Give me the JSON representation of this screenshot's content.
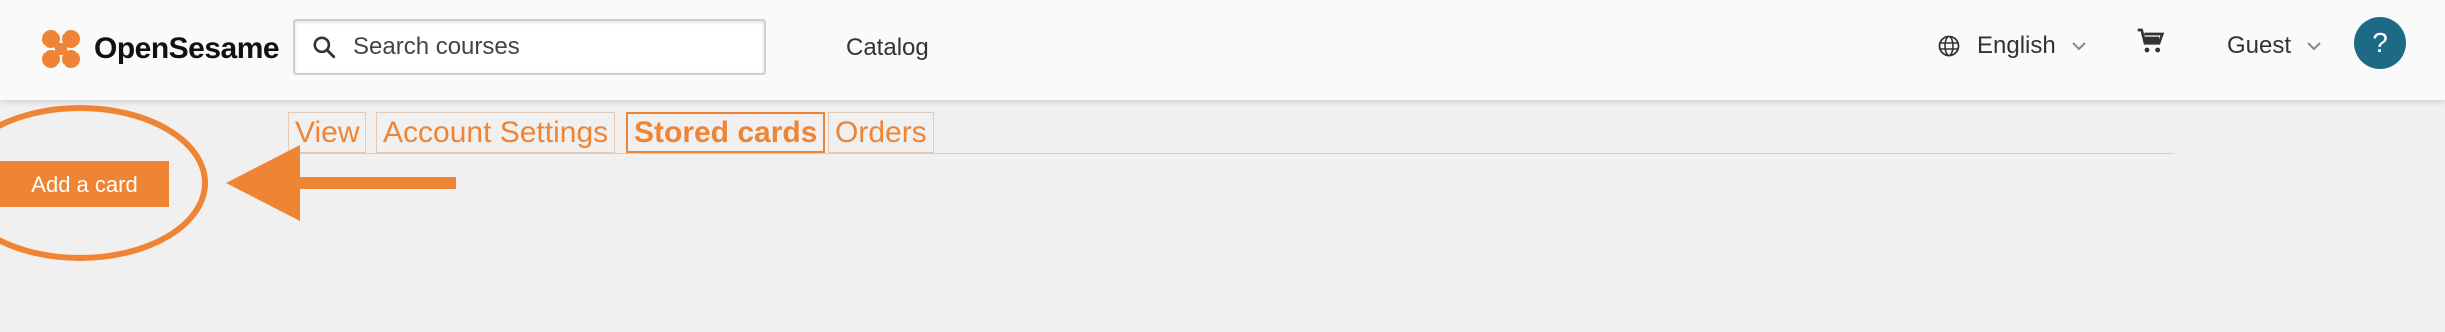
{
  "header": {
    "logo_text": "OpenSesame",
    "search": {
      "placeholder": "Search courses",
      "value": ""
    },
    "nav": {
      "catalog": "Catalog"
    },
    "language": "English",
    "user": "Guest",
    "help": "?"
  },
  "tabs": [
    {
      "label": "View",
      "active": false
    },
    {
      "label": "Account Settings",
      "active": false
    },
    {
      "label": "Stored cards",
      "active": true
    },
    {
      "label": "Orders",
      "active": false
    }
  ],
  "main": {
    "add_card_label": "Add a card"
  },
  "colors": {
    "accent": "#ef8534",
    "help_bg": "#1d6a86",
    "background": "#f0f0f0"
  },
  "icons": [
    "logo-mark-icon",
    "search-icon",
    "globe-icon",
    "chevron-down-icon",
    "cart-icon"
  ]
}
